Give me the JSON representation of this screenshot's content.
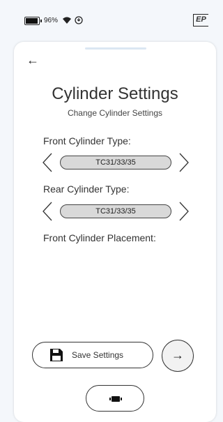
{
  "status": {
    "battery_percent": "96%",
    "battery_icon": "battery-icon",
    "wifi_icon": "wifi-icon",
    "sync_icon": "sync-icon",
    "logo_text": "EP"
  },
  "header": {
    "back_icon": "back-arrow-icon",
    "back_glyph": "←",
    "title": "Cylinder Settings",
    "subtitle": "Change Cylinder Settings"
  },
  "settings": {
    "front_type_label": "Front Cylinder Type:",
    "front_type_value": "TC31/33/35",
    "rear_type_label": "Rear Cylinder Type:",
    "rear_type_value": "TC31/33/35",
    "front_placement_label": "Front Cylinder Placement:"
  },
  "actions": {
    "save_label": "Save Settings",
    "save_icon": "floppy-disk-icon",
    "next_glyph": "→",
    "next_icon": "arrow-right-icon",
    "bottom_icon": "device-icon"
  },
  "colors": {
    "background": "#f4f7fb",
    "card": "#ffffff",
    "pill": "#d9d9d9",
    "handle": "#dbe6f2"
  }
}
